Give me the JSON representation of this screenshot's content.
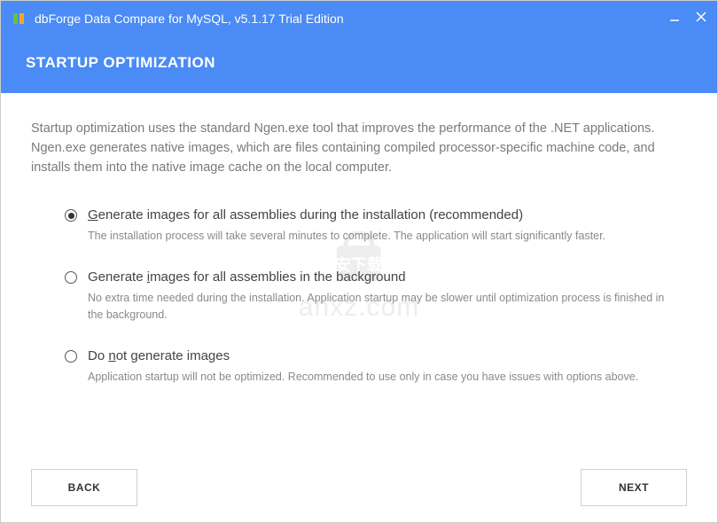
{
  "titlebar": {
    "title": "dbForge Data Compare for MySQL, v5.1.17 Trial Edition"
  },
  "header": {
    "title": "STARTUP OPTIMIZATION"
  },
  "intro": "Startup optimization uses the standard Ngen.exe tool that improves the performance of the .NET applications. Ngen.exe generates native images, which are files containing compiled processor-specific machine code, and installs them into the native image cache on the local computer.",
  "options": [
    {
      "label_pre": "",
      "label_u": "G",
      "label_post": "enerate images for all assemblies during the installation (recommended)",
      "desc": "The installation process will take several minutes to complete. The application will start significantly faster.",
      "selected": true
    },
    {
      "label_pre": "Generate ",
      "label_u": "i",
      "label_post": "mages for all assemblies in the background",
      "desc": "No extra time needed during the installation. Application startup may be slower until optimization process is finished in the background.",
      "selected": false
    },
    {
      "label_pre": "Do ",
      "label_u": "n",
      "label_post": "ot generate images",
      "desc": "Application startup will not be optimized. Recommended to use only in case you have issues with options above.",
      "selected": false
    }
  ],
  "buttons": {
    "back": "BACK",
    "next": "NEXT"
  },
  "watermark": {
    "text": "anxz.com"
  }
}
